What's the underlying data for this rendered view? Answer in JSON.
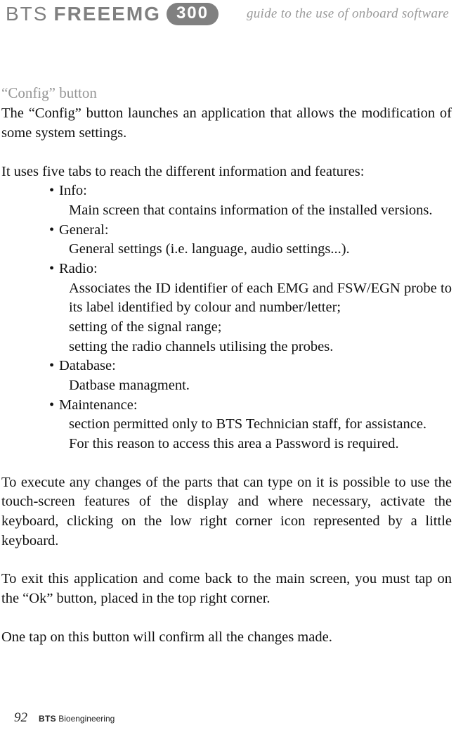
{
  "header": {
    "logo_bts": "BTS",
    "logo_emg": "FREEEMG",
    "badge": "300",
    "subtitle": "guide to the use of onboard software"
  },
  "section": {
    "title": "“Config” button",
    "intro": "The  “Config” button launches an application that allows the modification of some system settings.",
    "tabs_intro": "It uses five tabs to reach the different information and features:",
    "bullets": {
      "info_head": "Info:",
      "info_desc": "Main screen that contains information of the installed versions.",
      "general_head": "General:",
      "general_desc": "General settings (i.e. language, audio settings...).",
      "radio_head": "Radio:",
      "radio_desc_1": "Associates the ID identifier of each EMG and FSW/EGN probe to its label identified by colour and number/letter;",
      "radio_desc_2": "setting of the signal range;",
      "radio_desc_3": "setting the radio channels utilising the probes.",
      "db_head": "Database:",
      "db_desc": "Datbase managment.",
      "maint_head": "Maintenance:",
      "maint_desc_1": "section permitted only to BTS Technician staff, for assistance.",
      "maint_desc_2": "For this reason to access this area a Password is required."
    },
    "para_execute": "To execute any changes of the parts that can type on it is possible to use the touch-screen features of the display and where necessary, activate the keyboard, clicking on the low right corner icon represented by a little keyboard.",
    "para_exit": "To exit this application and come back to the main screen, you must tap on the “Ok” button, placed in the top right corner.",
    "para_confirm": "One tap on this button will confirm all the changes made."
  },
  "footer": {
    "page": "92",
    "brand_bold": "BTS",
    "brand_rest": " Bioengineering"
  }
}
